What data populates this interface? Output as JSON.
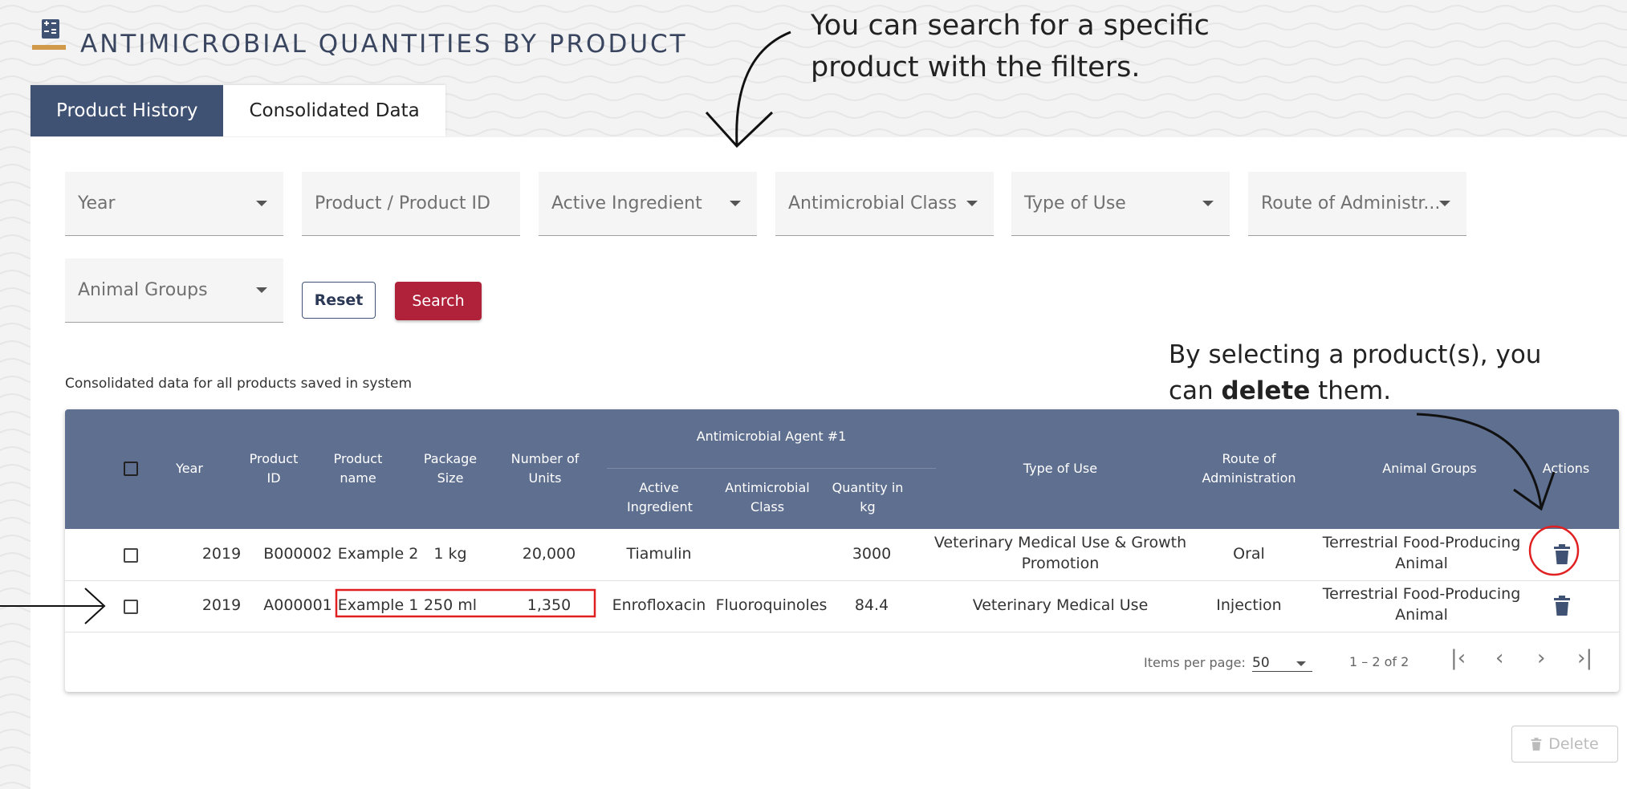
{
  "header": {
    "title": "ANTIMICROBIAL QUANTITIES BY PRODUCT",
    "logo_icon": "calculator-icon"
  },
  "tabs": [
    {
      "label": "Product History",
      "active": true
    },
    {
      "label": "Consolidated Data",
      "active": false
    }
  ],
  "filters": {
    "year": "Year",
    "product": "Product / Product ID",
    "active_ingredient": "Active Ingredient",
    "antimicrobial_class": "Antimicrobial Class",
    "type_of_use": "Type of Use",
    "route": "Route of Administr...",
    "animal_groups": "Animal Groups"
  },
  "buttons": {
    "reset": "Reset",
    "search": "Search",
    "delete": "Delete"
  },
  "caption": "Consolidated data for all products saved in system",
  "table": {
    "group_header": "Antimicrobial Agent #1",
    "headers": {
      "year": "Year",
      "product_id": "Product ID",
      "product_name": "Product name",
      "package_size": "Package Size",
      "number_of_units": "Number of Units",
      "active_ingredient": "Active Ingredient",
      "antimicrobial_class": "Antimicrobial Class",
      "quantity": "Quantity in kg",
      "type_of_use": "Type of Use",
      "route": "Route of Administration",
      "animal_groups": "Animal Groups",
      "actions": "Actions"
    },
    "rows": [
      {
        "year": "2019",
        "product_id": "B000002",
        "product_name": "Example 2",
        "package_size": "1 kg",
        "units": "20,000",
        "active_ingredient": "Tiamulin",
        "antimicrobial_class": "",
        "quantity": "3000",
        "type_of_use": "Veterinary Medical Use & Growth Promotion",
        "route": "Oral",
        "animal_groups": "Terrestrial Food-Producing Animal"
      },
      {
        "year": "2019",
        "product_id": "A000001",
        "product_name": "Example 1",
        "package_size": "250 ml",
        "units": "1,350",
        "active_ingredient": "Enrofloxacin",
        "antimicrobial_class": "Fluoroquinoles",
        "quantity": "84.4",
        "type_of_use": "Veterinary Medical Use",
        "route": "Injection",
        "animal_groups": "Terrestrial Food-Producing Animal"
      }
    ]
  },
  "paginator": {
    "items_per_page_label": "Items per page:",
    "items_per_page": "50",
    "range": "1 – 2 of 2"
  },
  "annotations": {
    "search_note": "You can search for a specific product with the filters.",
    "delete_note_prefix": "By selecting a product(s), you can ",
    "delete_note_bold": "delete",
    "delete_note_suffix": " them."
  },
  "colors": {
    "primary": "#3f5274",
    "header_row": "#5f6f90",
    "accent": "#b0213a",
    "annotation_red": "#e02020"
  }
}
